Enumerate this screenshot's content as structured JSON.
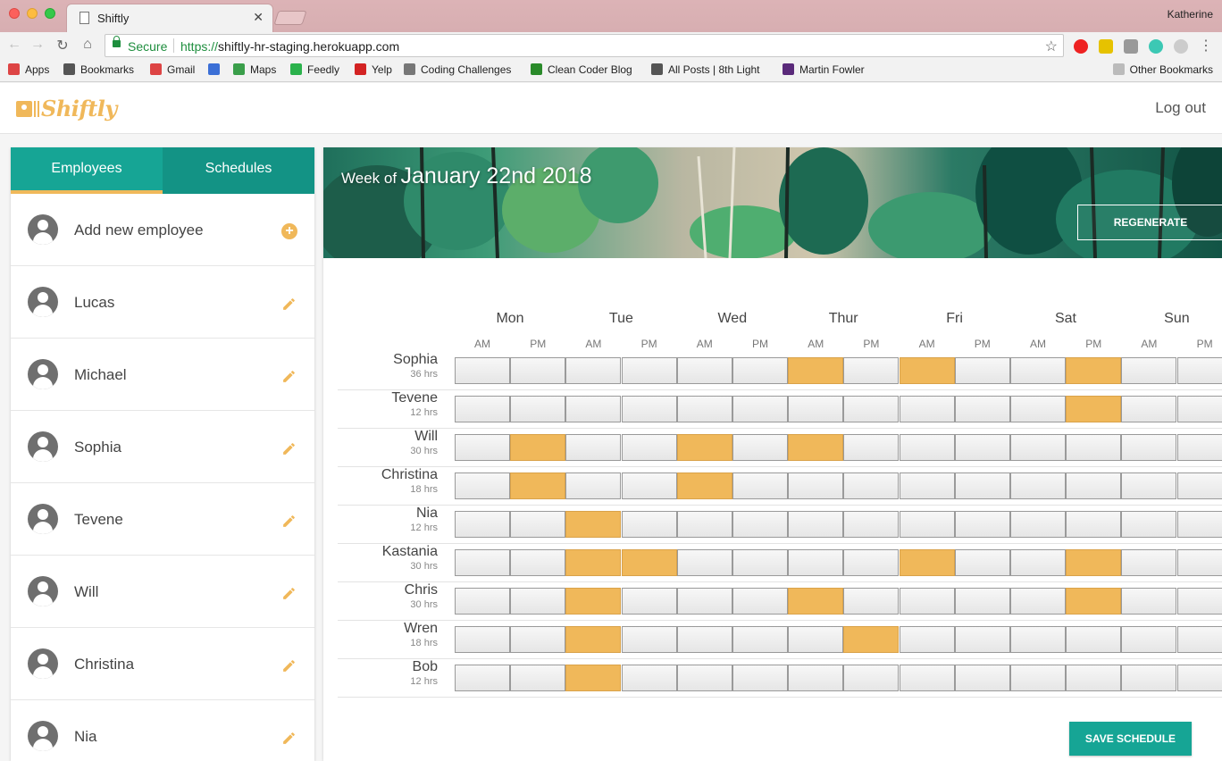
{
  "browser": {
    "tab_title": "Shiftly",
    "tab_close": "✕",
    "profile_name": "Katherine",
    "secure_label": "Secure",
    "url_scheme": "https://",
    "url_rest": "shiftly-hr-staging.herokuapp.com",
    "bookmarks": [
      {
        "label": "Apps",
        "icon": "apps-grid-icon",
        "color": "#d44"
      },
      {
        "label": "Bookmarks",
        "icon": "star-icon",
        "color": "#555"
      },
      {
        "label": "Gmail",
        "icon": "gmail-icon",
        "color": "#d44"
      },
      {
        "label": "",
        "icon": "calendar-icon",
        "color": "#3b6fd6"
      },
      {
        "label": "Maps",
        "icon": "maps-icon",
        "color": "#3a9e4a"
      },
      {
        "label": "Feedly",
        "icon": "feedly-icon",
        "color": "#2bb24c"
      },
      {
        "label": "Yelp",
        "icon": "yelp-icon",
        "color": "#d32323"
      },
      {
        "label": "Coding Challenges",
        "icon": "reddit-icon",
        "color": "#777"
      },
      {
        "label": "Clean Coder Blog",
        "icon": "globe-icon",
        "color": "#2a8a2a"
      },
      {
        "label": "All Posts | 8th Light",
        "icon": "8th-light-icon",
        "color": "#555"
      },
      {
        "label": "Martin Fowler",
        "icon": "martin-fowler-icon",
        "color": "#5a2a7a"
      }
    ],
    "other_bookmarks": "Other Bookmarks",
    "calendar_badge": "23"
  },
  "app": {
    "logo_text": "Shiftly",
    "logout_label": "Log out",
    "colors": {
      "teal": "#16a595",
      "accent": "#f0b85a"
    }
  },
  "sidebar": {
    "tabs": [
      {
        "label": "Employees",
        "active": true
      },
      {
        "label": "Schedules",
        "active": false
      }
    ],
    "add_label": "Add new employee",
    "employees": [
      "Lucas",
      "Michael",
      "Sophia",
      "Tevene",
      "Will",
      "Christina",
      "Nia"
    ]
  },
  "schedule": {
    "week_prefix": "Week of",
    "week_date": "January 22nd 2018",
    "regenerate_label": "REGENERATE",
    "save_label": "SAVE SCHEDULE",
    "days": [
      "Mon",
      "Tue",
      "Wed",
      "Thur",
      "Fri",
      "Sat",
      "Sun"
    ],
    "am_label": "AM",
    "pm_label": "PM",
    "rows": [
      {
        "name": "Sophia",
        "hours": "36 hrs",
        "shifts": [
          6,
          8,
          11
        ]
      },
      {
        "name": "Tevene",
        "hours": "12 hrs",
        "shifts": [
          11
        ]
      },
      {
        "name": "Will",
        "hours": "30 hrs",
        "shifts": [
          1,
          4,
          6
        ]
      },
      {
        "name": "Christina",
        "hours": "18 hrs",
        "shifts": [
          1,
          4
        ]
      },
      {
        "name": "Nia",
        "hours": "12 hrs",
        "shifts": [
          2
        ]
      },
      {
        "name": "Kastania",
        "hours": "30 hrs",
        "shifts": [
          2,
          3,
          8,
          11
        ]
      },
      {
        "name": "Chris",
        "hours": "30 hrs",
        "shifts": [
          2,
          6,
          11
        ]
      },
      {
        "name": "Wren",
        "hours": "18 hrs",
        "shifts": [
          2,
          7
        ]
      },
      {
        "name": "Bob",
        "hours": "12 hrs",
        "shifts": [
          2
        ]
      }
    ]
  }
}
